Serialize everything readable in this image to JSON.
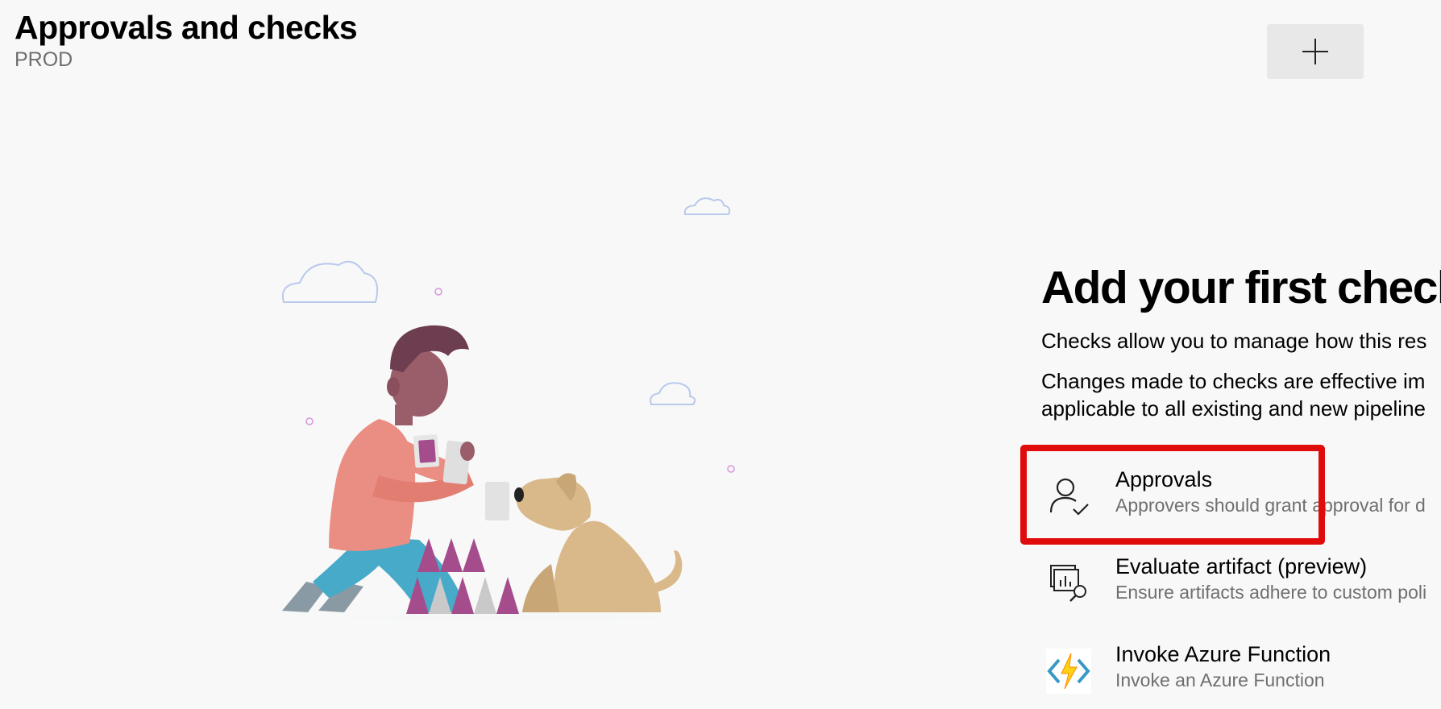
{
  "header": {
    "title": "Approvals and checks",
    "subtitle": "PROD",
    "add_button_icon": "plus-icon"
  },
  "empty_state": {
    "title": "Add your first check",
    "description_1": "Checks allow you to manage how this res",
    "description_2": "Changes made to checks are effective im",
    "description_3": "applicable to all existing and new pipeline"
  },
  "checks": [
    {
      "name": "Approvals",
      "description": "Approvers should grant approval for d",
      "icon": "person-check-icon",
      "highlighted": true
    },
    {
      "name": "Evaluate artifact (preview)",
      "description": "Ensure artifacts adhere to custom poli",
      "icon": "artifact-search-icon"
    },
    {
      "name": "Invoke Azure Function",
      "description": "Invoke an Azure Function",
      "icon": "azure-function-icon"
    }
  ],
  "colors": {
    "highlight": "#e00b0b",
    "background": "#f8f8f8",
    "button_background": "#e8e8e8",
    "secondary_text": "#6f6f6f"
  }
}
